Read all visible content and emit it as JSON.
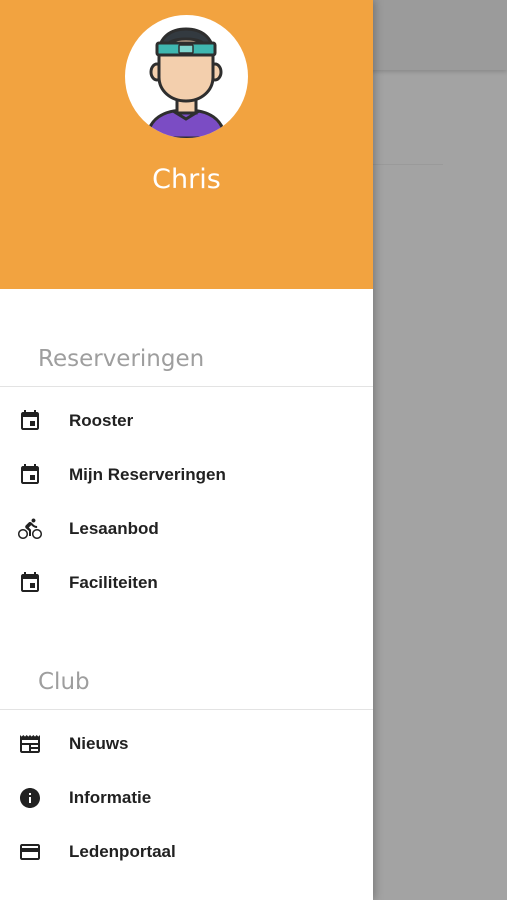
{
  "user": {
    "name": "Chris"
  },
  "colors": {
    "header_background": "#f2a340",
    "scrim": "#a3a3a3",
    "section_title": "#9e9e9e",
    "menu_text": "#212121"
  },
  "sections": [
    {
      "title": "Reserveringen",
      "items": [
        {
          "label": "Rooster",
          "icon": "calendar-icon"
        },
        {
          "label": "Mijn Reserveringen",
          "icon": "calendar-icon"
        },
        {
          "label": "Lesaanbod",
          "icon": "bicycle-icon"
        },
        {
          "label": "Faciliteiten",
          "icon": "calendar-icon"
        }
      ]
    },
    {
      "title": "Club",
      "items": [
        {
          "label": "Nieuws",
          "icon": "newspaper-icon"
        },
        {
          "label": "Informatie",
          "icon": "info-icon"
        },
        {
          "label": "Ledenportaal",
          "icon": "credit-card-icon"
        }
      ]
    }
  ]
}
